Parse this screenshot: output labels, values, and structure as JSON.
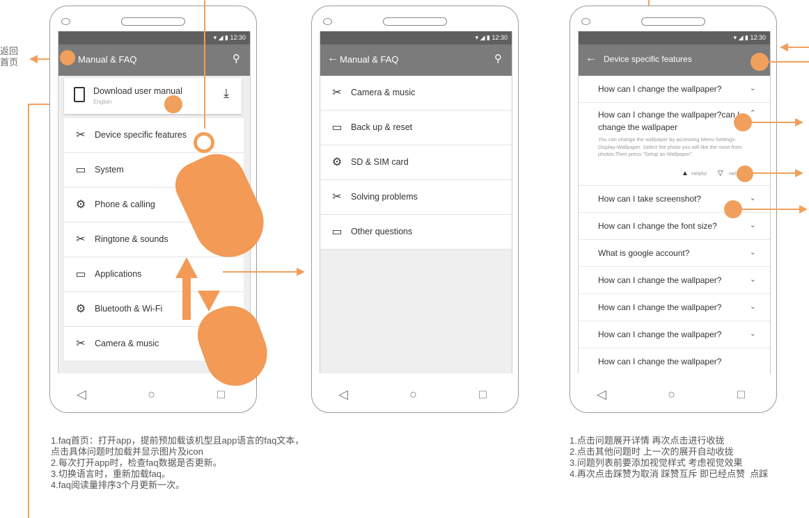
{
  "left_annotation": {
    "line1": "返回",
    "line2": "首页"
  },
  "phone1": {
    "status_time": "12:30",
    "title": "Manual & FAQ",
    "download": {
      "label": "Download user manual",
      "sub": "English"
    },
    "items": [
      {
        "label": "Device specific features"
      },
      {
        "label": "System"
      },
      {
        "label": "Phone & calling"
      },
      {
        "label": "Ringtone & sounds"
      },
      {
        "label": "Applications"
      },
      {
        "label": "Bluetooth & Wi-Fi"
      },
      {
        "label": "Camera & music"
      }
    ]
  },
  "phone2": {
    "status_time": "12:30",
    "title": "Manual & FAQ",
    "items": [
      {
        "label": "Camera & music"
      },
      {
        "label": "Back up & reset"
      },
      {
        "label": "SD & SIM card"
      },
      {
        "label": "Solving problems"
      },
      {
        "label": "Other questions"
      }
    ]
  },
  "phone3": {
    "status_time": "12:30",
    "title": "Device specific features",
    "expanded": {
      "question": "How can I change the wallpaper?can I change the wallpaper",
      "answer": "You can change the wallpaper by accessing Menu-Settings-Display-Wallpaper. Select the photo you will like the most from photos.Then press \"Setup as Wallpaper\".",
      "helpful": "Helpful",
      "not_helpful": "Helpless"
    },
    "faqs_top": [
      "How can I change the wallpaper?"
    ],
    "faqs": [
      "How can I take screenshot?",
      "How can I change the font size?",
      "What is google account?",
      "How can I change the wallpaper?",
      "How can I change the wallpaper?",
      "How can I change the wallpaper?",
      "How can I change the wallpaper?"
    ]
  },
  "notes_left": "1.faq首页：打开app，提前预加载该机型且app语言的faq文本，\n点击具体问题时加载并显示图片及icon\n2.每次打开app时，检查faq数据是否更新。\n3.切换语言时，重新加载faq。\n4.faq阅读量排序3个月更新一次。",
  "notes_right": "1.点击问题展开详情 再次点击进行收拢\n2.点击其他问题时 上一次的展开自动收拢\n3.问题列表前要添加视觉样式 考虑视觉效果\n4.再次点击踩赞为取消 踩赞互斥 即已经点赞  点踩",
  "colors": {
    "accent": "#f0a05c",
    "appbar": "#7b7b7b",
    "statusbar": "#5f5f5f"
  }
}
